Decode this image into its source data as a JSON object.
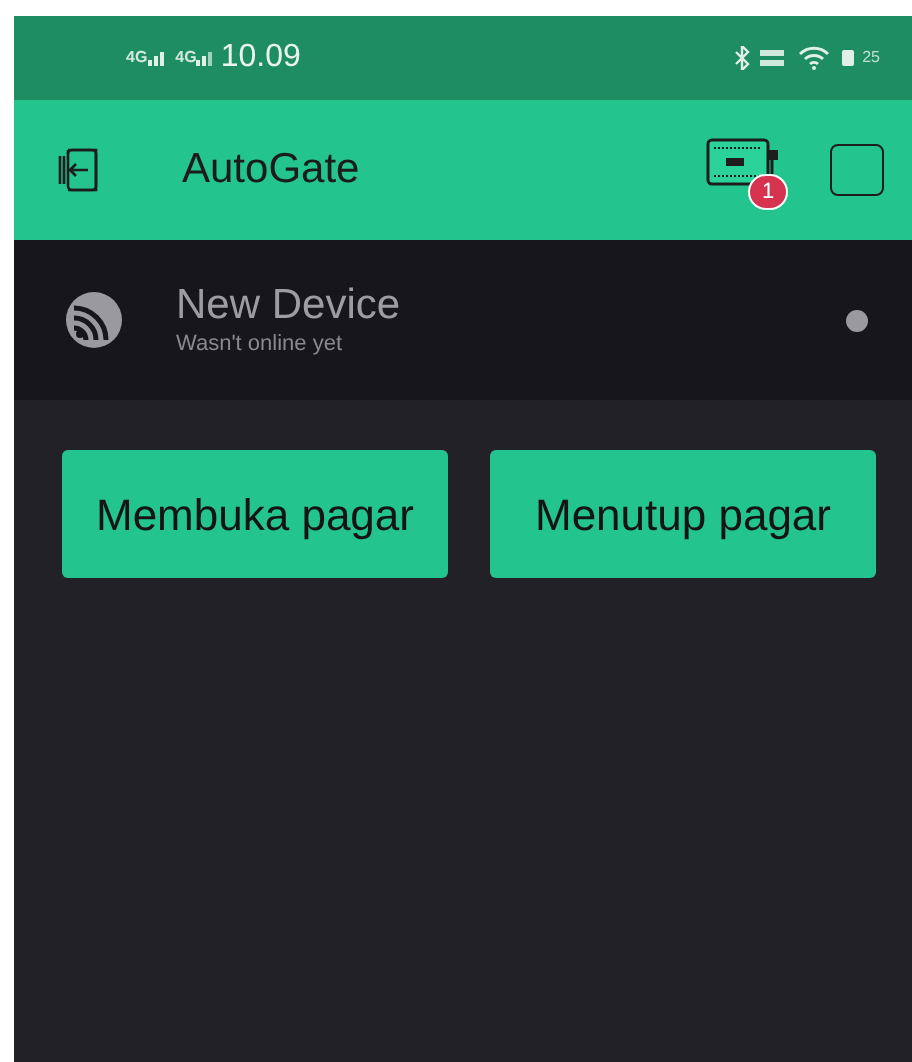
{
  "status_bar": {
    "network_1": "4G",
    "network_2": "4G",
    "time": "10.09",
    "battery": "25"
  },
  "app_bar": {
    "title": "AutoGate",
    "badge": "1"
  },
  "device": {
    "name": "New Device",
    "status": "Wasn't online yet",
    "online": false
  },
  "buttons": [
    {
      "label": "Membuka pagar"
    },
    {
      "label": "Menutup pagar"
    }
  ]
}
